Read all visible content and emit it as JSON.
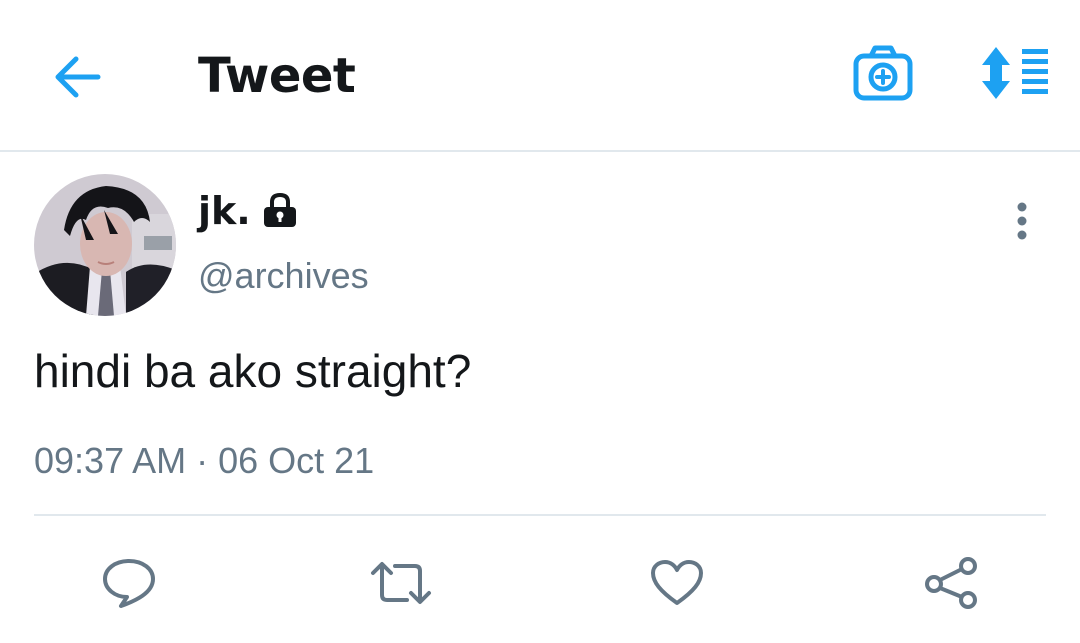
{
  "header": {
    "title": "Tweet",
    "back_icon": "arrow-left-icon",
    "camera_icon": "camera-plus-icon",
    "sort_icon": "sort-list-icon",
    "accent_color": "#1da1f2"
  },
  "tweet": {
    "author_name": "jk.",
    "author_handle": "@archives",
    "protected_icon": "lock-icon",
    "text": "hindi ba ako straight?",
    "timestamp": "09:37 AM · 06 Oct 21",
    "more_icon": "vertical-dots-icon"
  },
  "actions": [
    {
      "name": "reply",
      "icon": "reply-bubble-icon"
    },
    {
      "name": "retweet",
      "icon": "retweet-icon"
    },
    {
      "name": "like",
      "icon": "heart-icon"
    },
    {
      "name": "share",
      "icon": "share-icon"
    }
  ],
  "colors": {
    "text_primary": "#14171a",
    "text_secondary": "#657786",
    "divider": "#e1e8ed",
    "icon_gray": "#657786"
  }
}
